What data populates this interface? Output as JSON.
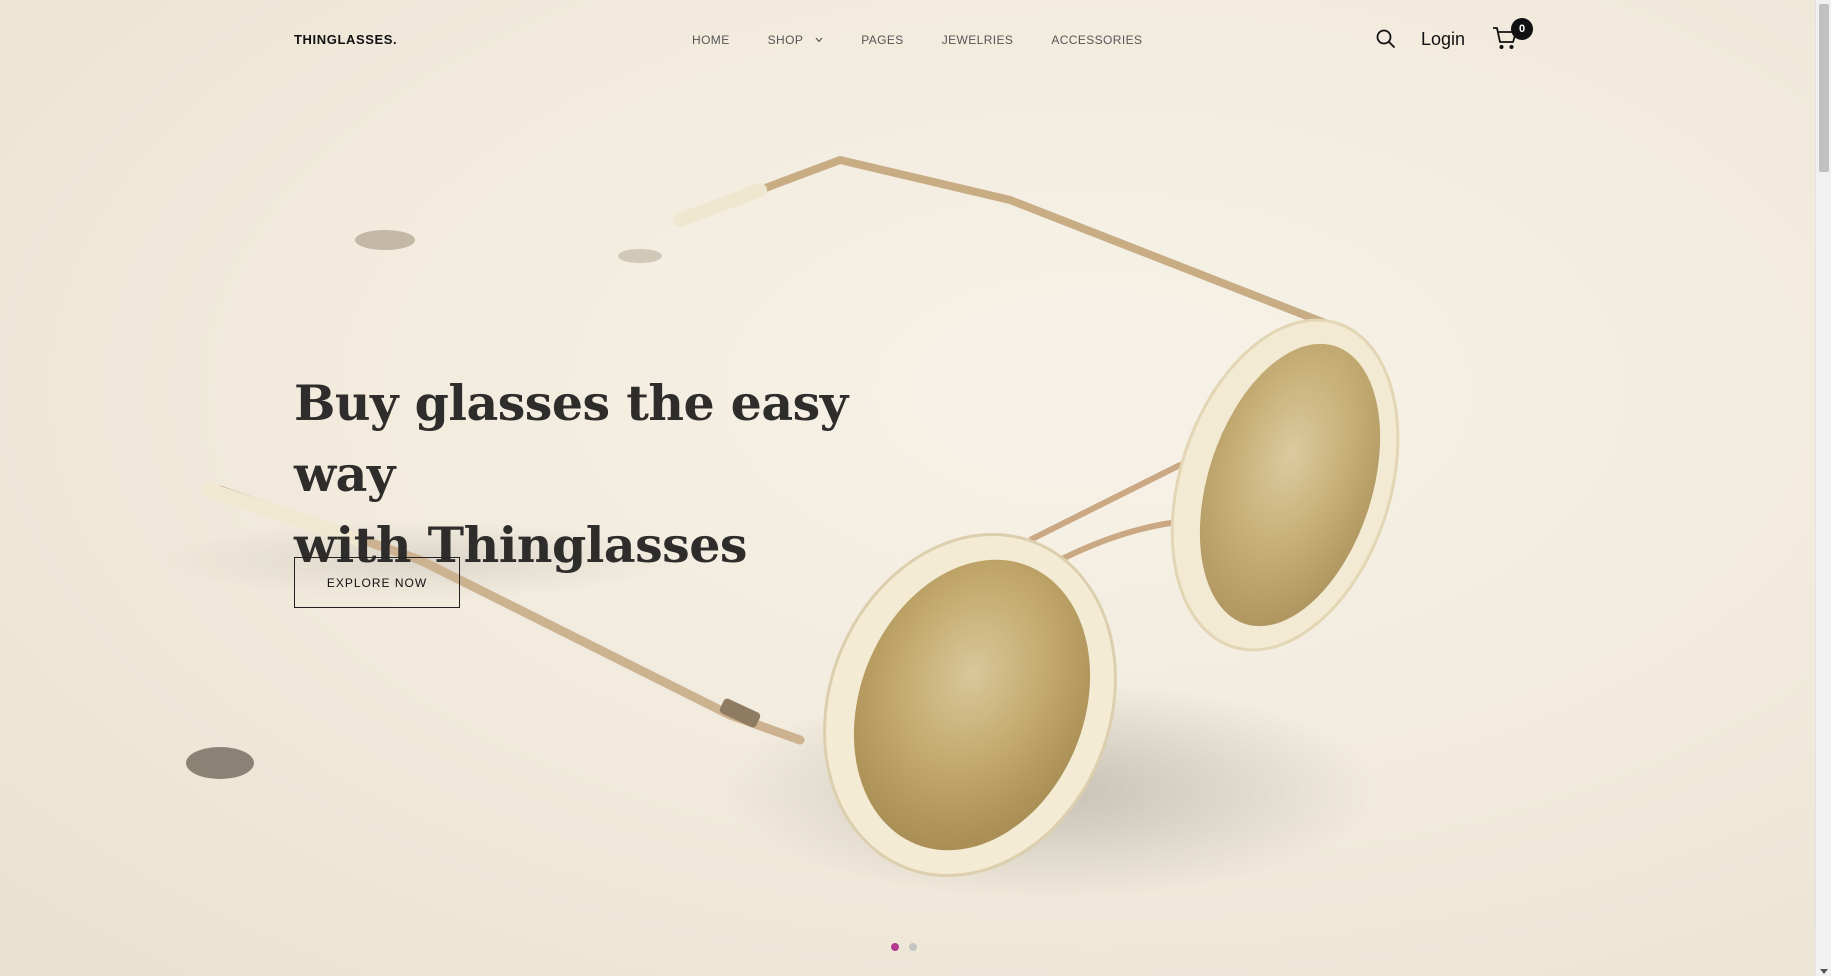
{
  "header": {
    "logo": "THINGLASSES.",
    "nav": [
      {
        "label": "HOME"
      },
      {
        "label": "SHOP"
      },
      {
        "label": "PAGES"
      },
      {
        "label": "JEWELRIES"
      },
      {
        "label": "ACCESSORIES"
      }
    ],
    "login_label": "Login",
    "cart_count": "0"
  },
  "hero": {
    "title_line1": "Buy glasses the easy way",
    "title_line2": "with Thinglasses",
    "cta_label": "EXPLORE NOW",
    "slides": [
      {
        "active": true
      },
      {
        "active": false
      }
    ]
  },
  "colors": {
    "background": "#f1eadc",
    "text_dark": "#2f2d2b",
    "dot_active": "#b3388f",
    "dot_inactive": "#c4c4c4"
  },
  "icons": {
    "search": "search-icon",
    "cart": "cart-icon",
    "chevron": "chevron-down-icon"
  }
}
